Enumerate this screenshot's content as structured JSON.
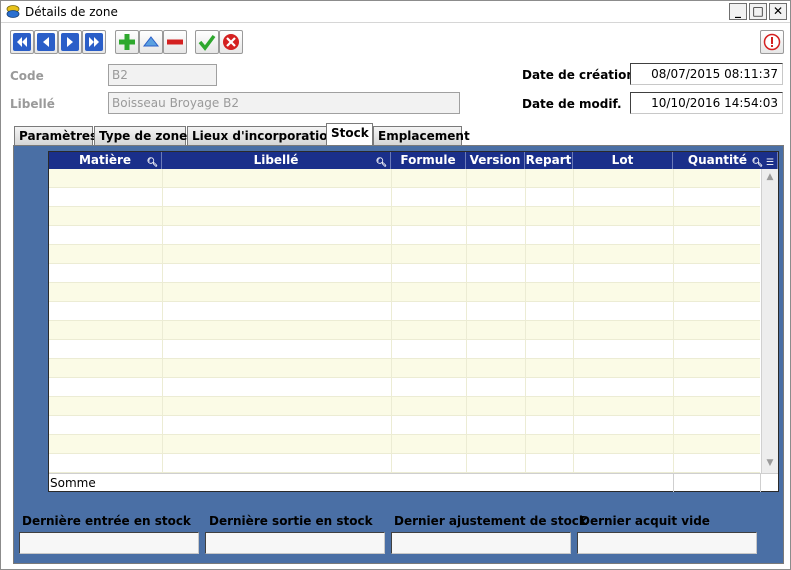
{
  "window": {
    "title": "Détails de zone",
    "minimize": "_",
    "maximize": "□",
    "close": "✕"
  },
  "toolbar": {
    "icons": [
      "first-icon",
      "previous-icon",
      "next-icon",
      "last-icon",
      "add-icon",
      "up-icon",
      "remove-icon",
      "validate-icon",
      "cancel-icon",
      "info-icon"
    ]
  },
  "form": {
    "code_label": "Code",
    "code_value": "B2",
    "libelle_label": "Libellé",
    "libelle_value": "Boisseau Broyage B2",
    "date_creation_label": "Date de création",
    "date_creation_value": "08/07/2015 08:11:37",
    "date_modif_label": "Date de modif.",
    "date_modif_value": "10/10/2016 14:54:03"
  },
  "tabs": [
    {
      "label": "Paramètres",
      "active": false
    },
    {
      "label": "Type de zone",
      "active": false
    },
    {
      "label": "Lieux d'incorporation",
      "active": false
    },
    {
      "label": "Stock",
      "active": true
    },
    {
      "label": "Emplacement",
      "active": false
    }
  ],
  "grid": {
    "columns": [
      "Matière",
      "Libellé",
      "Formule",
      "Version",
      "Repart",
      "Lot",
      "Quantité"
    ],
    "rows": [],
    "sum_label": "Somme"
  },
  "footer": {
    "derniere_entree_label": "Dernière entrée en stock",
    "derniere_entree_value": "",
    "derniere_sortie_label": "Dernière sortie en stock",
    "derniere_sortie_value": "",
    "dernier_ajustement_label": "Dernier ajustement de stock",
    "dernier_ajustement_value": "",
    "dernier_acquit_label": "Dernier acquit vide",
    "dernier_acquit_value": ""
  },
  "colors": {
    "panel_bg": "#4a6fa5",
    "grid_header_bg": "#1a2f8a",
    "row_alt_bg": "#fbfbe6",
    "add_green": "#2ea82e",
    "remove_red": "#d42020",
    "nav_blue": "#2a5ec8"
  }
}
